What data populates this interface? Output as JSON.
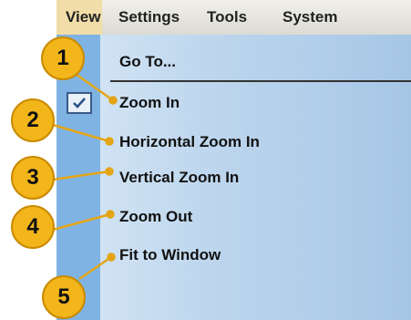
{
  "menubar": {
    "items": [
      {
        "label": "View",
        "active": true
      },
      {
        "label": "Settings"
      },
      {
        "label": "Tools"
      },
      {
        "label": "System"
      }
    ]
  },
  "view_menu": {
    "items": [
      {
        "label": "Go To...",
        "checked": false
      },
      {
        "label": "Zoom In",
        "checked": true
      },
      {
        "label": "Horizontal Zoom In",
        "checked": false
      },
      {
        "label": "Vertical Zoom In",
        "checked": false
      },
      {
        "label": "Zoom Out",
        "checked": false
      },
      {
        "label": "Fit to Window",
        "checked": false
      }
    ]
  },
  "callouts": [
    "1",
    "2",
    "3",
    "4",
    "5"
  ],
  "colors": {
    "callout_fill": "#f2b51a",
    "leader_line": "#e3a516",
    "menu_highlight": "#f1dda7",
    "menu_bg": "#bfd7ee"
  }
}
